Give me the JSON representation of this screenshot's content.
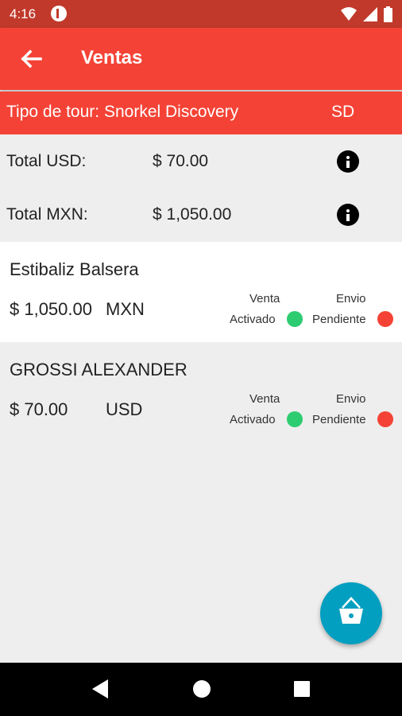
{
  "status_bar": {
    "time": "4:16"
  },
  "app_bar": {
    "title": "Ventas"
  },
  "tour": {
    "label": "Tipo de tour: Snorkel Discovery",
    "code": "SD"
  },
  "totals": [
    {
      "label": "Total USD:",
      "value": "$ 70.00"
    },
    {
      "label": "Total MXN:",
      "value": "$ 1,050.00"
    }
  ],
  "sales": [
    {
      "name": "Estibaliz Balsera",
      "amount": "$ 1,050.00",
      "currency": "MXN",
      "venta_label": "Venta",
      "venta_status": "Activado",
      "envio_label": "Envio",
      "envio_status": "Pendiente"
    },
    {
      "name": "GROSSI ALEXANDER",
      "amount": "$ 70.00",
      "currency": "USD",
      "venta_label": "Venta",
      "venta_status": "Activado",
      "envio_label": "Envio",
      "envio_status": "Pendiente"
    }
  ],
  "colors": {
    "primary": "#f44336",
    "status_bar": "#c0392b",
    "active": "#2ecc71",
    "pending": "#f44336",
    "fab": "#039fc0"
  },
  "icons": {
    "back": "arrow-left-icon",
    "info": "info-icon",
    "fab": "basket-icon"
  }
}
